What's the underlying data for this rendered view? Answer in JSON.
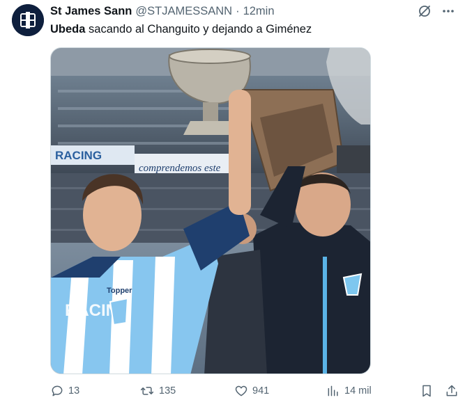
{
  "author": {
    "name": "St James Sann",
    "handle": "@STJAMESSANN",
    "separator": "·",
    "time": "12min",
    "avatar_icon": "club-crest-avatar"
  },
  "post": {
    "text_bold": "Ubeda",
    "text_rest": " sacando al Changuito y dejando a Giménez"
  },
  "media": {
    "image_icon": "photo-players-trophy",
    "banner_left": "RACING",
    "banner_right": "comprendemos este",
    "jersey_sponsor": "Topper",
    "jersey_text": "RACING"
  },
  "top_actions": [
    "grok-icon",
    "more-icon"
  ],
  "actions": {
    "replies": "13",
    "reposts": "135",
    "likes": "941",
    "views": "14 mil"
  },
  "colors": {
    "accent": "#1d9bf0",
    "muted": "#536471",
    "text": "#0f1419",
    "avatar_bg": "#0e1f3d"
  }
}
